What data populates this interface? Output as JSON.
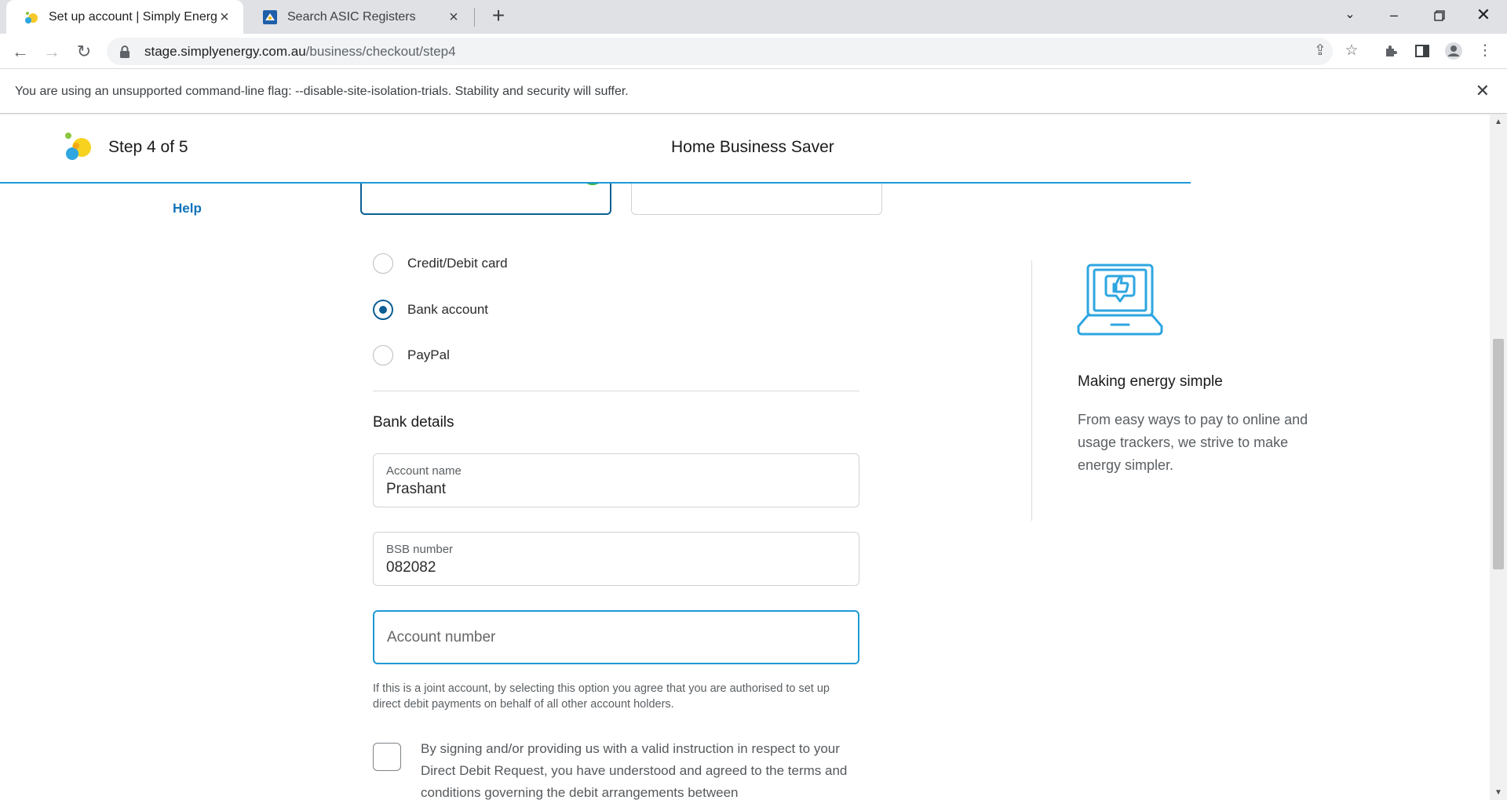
{
  "browser": {
    "tabs": [
      {
        "title": "Set up account | Simply Energy",
        "active": true
      },
      {
        "title": "Search ASIC Registers",
        "active": false
      }
    ],
    "url_host": "stage.simplyenergy.com.au",
    "url_path": "/business/checkout/step4",
    "infobar_message": "You are using an unsupported command-line flag: --disable-site-isolation-trials. Stability and security will suffer."
  },
  "header": {
    "step": "Step 4 of 5",
    "plan": "Home Business Saver"
  },
  "sidebar": {
    "help": "Help"
  },
  "payment_methods": [
    {
      "label": "Credit/Debit card",
      "selected": false
    },
    {
      "label": "Bank account",
      "selected": true
    },
    {
      "label": "PayPal",
      "selected": false
    }
  ],
  "bank_details": {
    "title": "Bank details",
    "account_name_label": "Account name",
    "account_name_value": "Prashant",
    "bsb_label": "BSB number",
    "bsb_value": "082082",
    "account_number_placeholder": "Account number",
    "disclaimer": "If this is a joint account, by selecting this option you agree that you are authorised to set up direct debit payments on behalf of all other account holders.",
    "agreement": "By signing and/or providing us with a valid instruction in respect to your Direct Debit Request, you have understood and agreed to the terms and conditions governing the debit arrangements between"
  },
  "promo": {
    "icon": "laptop-thumbs-up-icon",
    "title": "Making energy simple",
    "text": "From easy ways to pay to online and usage trackers, we strive to make energy simpler."
  },
  "colors": {
    "accent": "#1e9ad6",
    "selected_border": "#0b5f94",
    "link": "#0d72b9",
    "success": "#2fb344"
  }
}
